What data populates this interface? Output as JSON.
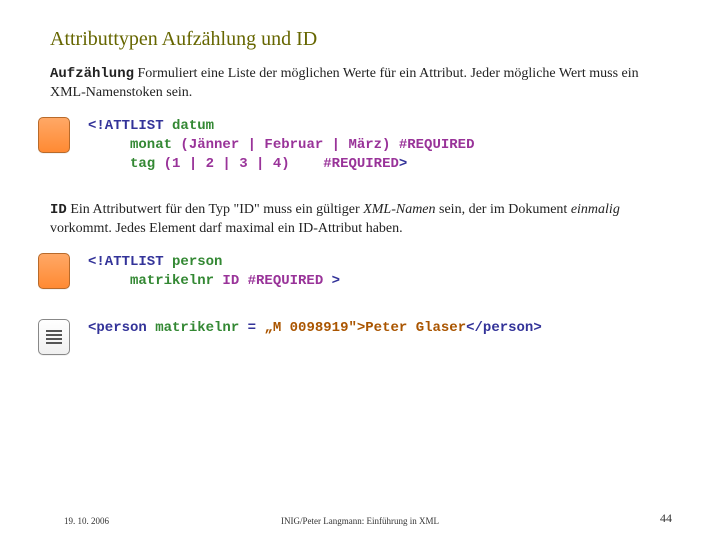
{
  "title": "Attributtypen  Aufzählung und ID",
  "p1_term": "Aufzählung",
  "p1_text": "  Formuliert eine Liste der möglichen Werte für ein Attribut. Jeder mögliche Wert muss ein XML-Namenstoken sein.",
  "code1_l1a": "<!ATTLIST ",
  "code1_l1b": "datum",
  "code1_l2a": "     monat ",
  "code1_l2b": "(Jänner | Februar | März) #REQUIRED",
  "code1_l3a": "     tag ",
  "code1_l3b": "(1 | 2 | 3 | 4)",
  "code1_l3c": "    #REQUIRED",
  "code1_l3d": ">",
  "p2_term": "ID",
  "p2_a": "  Ein Attributwert für den Typ \"ID\" muss ein gültiger ",
  "p2_i1": "XML-Namen",
  "p2_b": " sein, der im Dokument ",
  "p2_i2": "einmalig",
  "p2_c": " vorkommt. Jedes Element darf maximal ein ID-Attribut haben.",
  "code2_l1a": "<!ATTLIST ",
  "code2_l1b": "person",
  "code2_l2a": "     matrikelnr ",
  "code2_l2b": "ID #REQUIRED ",
  "code2_l2c": ">",
  "code3_a": "<person ",
  "code3_b": "matrikelnr",
  "code3_c": " = ",
  "code3_d": "„M 0098919\">",
  "code3_e": "Peter Glaser",
  "code3_f": "</person>",
  "footer_date": "19. 10. 2006",
  "footer_center": "INIG/Peter Langmann: Einführung in XML",
  "footer_page": "44"
}
